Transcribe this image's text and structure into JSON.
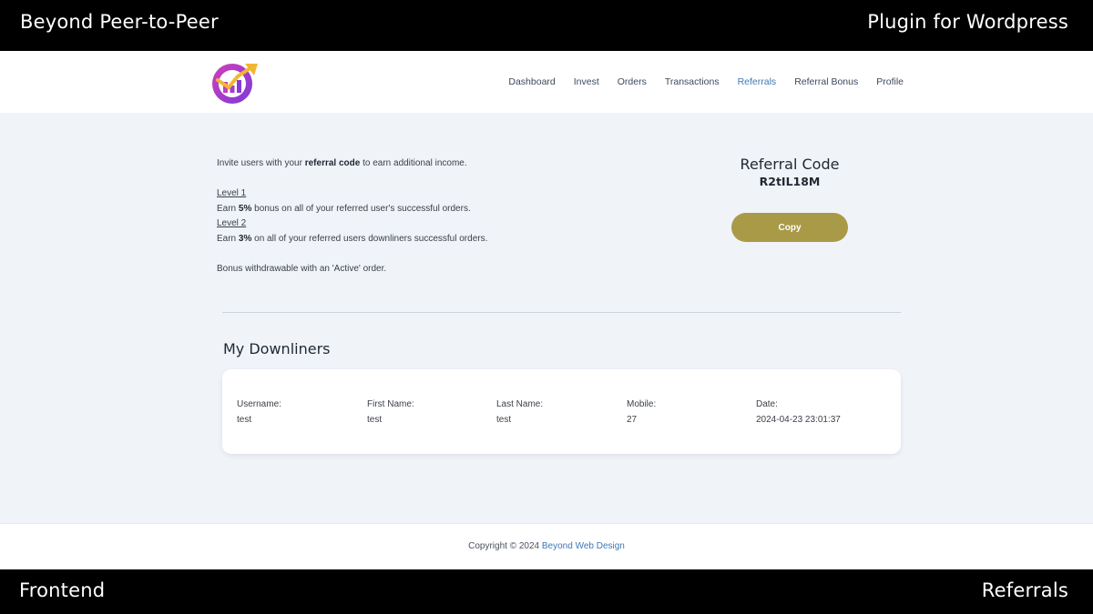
{
  "banner": {
    "top_left": "Beyond Peer-to-Peer",
    "top_right": "Plugin for Wordpress",
    "bottom_left": "Frontend",
    "bottom_right": "Referrals"
  },
  "nav": {
    "items": [
      "Dashboard",
      "Invest",
      "Orders",
      "Transactions",
      "Referrals",
      "Referral Bonus",
      "Profile"
    ],
    "active": "Referrals"
  },
  "intro": {
    "line1_pre": "Invite users with your ",
    "line1_bold": "referral code",
    "line1_post": " to earn additional income.",
    "level1_label": "Level 1",
    "level1_pre": "Earn ",
    "level1_bold": "5%",
    "level1_post": " bonus on all of your referred user's successful orders.",
    "level2_label": "Level 2",
    "level2_pre": "Earn ",
    "level2_bold": "3%",
    "level2_post": " on all of your referred users downliners successful orders.",
    "note": "Bonus withdrawable with an 'Active' order."
  },
  "referral": {
    "title": "Referral Code",
    "code": "R2tIL18M",
    "copy_label": "Copy"
  },
  "downliners": {
    "title": "My Downliners",
    "columns": [
      {
        "label": "Username:",
        "value": "test"
      },
      {
        "label": "First Name:",
        "value": "test"
      },
      {
        "label": "Last Name:",
        "value": "test"
      },
      {
        "label": "Mobile:",
        "value": "27"
      },
      {
        "label": "Date:",
        "value": "2024-04-23 23:01:37"
      }
    ]
  },
  "footer": {
    "prefix": "Copyright © 2024 ",
    "link": "Beyond Web Design"
  },
  "colors": {
    "accent": "#3d78b4",
    "button": "#a99a47",
    "background": "#f0f4f9"
  }
}
